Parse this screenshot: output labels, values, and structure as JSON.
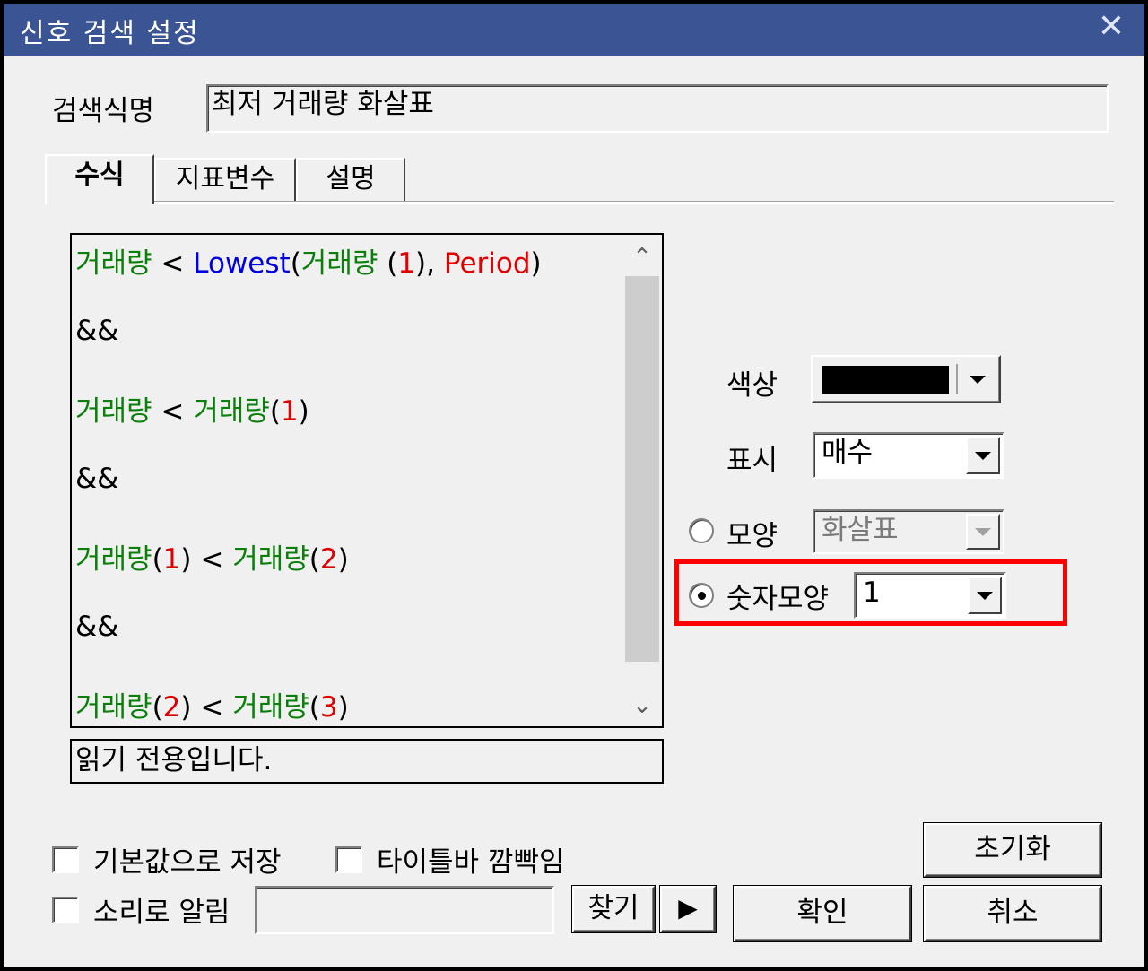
{
  "window": {
    "title": "신호 검색 설정",
    "close_glyph": "✕"
  },
  "name_field": {
    "label": "검색식명",
    "value": "최저 거래량 화살표"
  },
  "tabs": [
    {
      "label": "수식",
      "active": true
    },
    {
      "label": "지표변수",
      "active": false
    },
    {
      "label": "설명",
      "active": false
    }
  ],
  "formula": {
    "lines": [
      [
        {
          "t": "거래량",
          "c": "green"
        },
        {
          "t": " < ",
          "c": "black"
        },
        {
          "t": "Lowest",
          "c": "blue"
        },
        {
          "t": "(",
          "c": "black"
        },
        {
          "t": "거래량",
          "c": "green"
        },
        {
          "t": " (",
          "c": "black"
        },
        {
          "t": "1",
          "c": "red"
        },
        {
          "t": "), ",
          "c": "black"
        },
        {
          "t": "Period",
          "c": "red"
        },
        {
          "t": ")",
          "c": "black"
        }
      ],
      [
        {
          "t": "&&",
          "c": "black"
        }
      ],
      [
        {
          "t": "거래량",
          "c": "green"
        },
        {
          "t": " < ",
          "c": "black"
        },
        {
          "t": "거래량",
          "c": "green"
        },
        {
          "t": "(",
          "c": "black"
        },
        {
          "t": "1",
          "c": "red"
        },
        {
          "t": ")",
          "c": "black"
        }
      ],
      [
        {
          "t": "&&",
          "c": "black"
        }
      ],
      [
        {
          "t": "거래량",
          "c": "green"
        },
        {
          "t": "(",
          "c": "black"
        },
        {
          "t": "1",
          "c": "red"
        },
        {
          "t": ") < ",
          "c": "black"
        },
        {
          "t": "거래량",
          "c": "green"
        },
        {
          "t": "(",
          "c": "black"
        },
        {
          "t": "2",
          "c": "red"
        },
        {
          "t": ")",
          "c": "black"
        }
      ],
      [
        {
          "t": "&&",
          "c": "black"
        }
      ],
      [
        {
          "t": "거래량",
          "c": "green"
        },
        {
          "t": "(",
          "c": "black"
        },
        {
          "t": "2",
          "c": "red"
        },
        {
          "t": ") < ",
          "c": "black"
        },
        {
          "t": "거래량",
          "c": "green"
        },
        {
          "t": "(",
          "c": "black"
        },
        {
          "t": "3",
          "c": "red"
        },
        {
          "t": ")",
          "c": "black"
        }
      ]
    ],
    "status": "읽기 전용입니다."
  },
  "colors": {
    "title_bar": "#3a5494",
    "green": "#0a7f0a",
    "blue": "#0000e0",
    "red": "#e00000",
    "highlight": "#ff0000",
    "swatch": "#000000"
  },
  "options": {
    "color_label": "색상",
    "display_label": "표시",
    "display_value": "매수",
    "shape_label": "모양",
    "shape_value": "화살표",
    "shape_selected": false,
    "number_shape_label": "숫자모양",
    "number_shape_value": "1",
    "number_shape_selected": true
  },
  "bottom": {
    "save_default_label": "기본값으로 저장",
    "save_default_checked": false,
    "titlebar_blink_label": "타이틀바 깜빡임",
    "titlebar_blink_checked": false,
    "sound_alert_label": "소리로 알림",
    "sound_alert_checked": false,
    "sound_path_value": "",
    "find_label": "찾기",
    "play_glyph": "▶",
    "reset_label": "초기화",
    "ok_label": "확인",
    "cancel_label": "취소"
  }
}
